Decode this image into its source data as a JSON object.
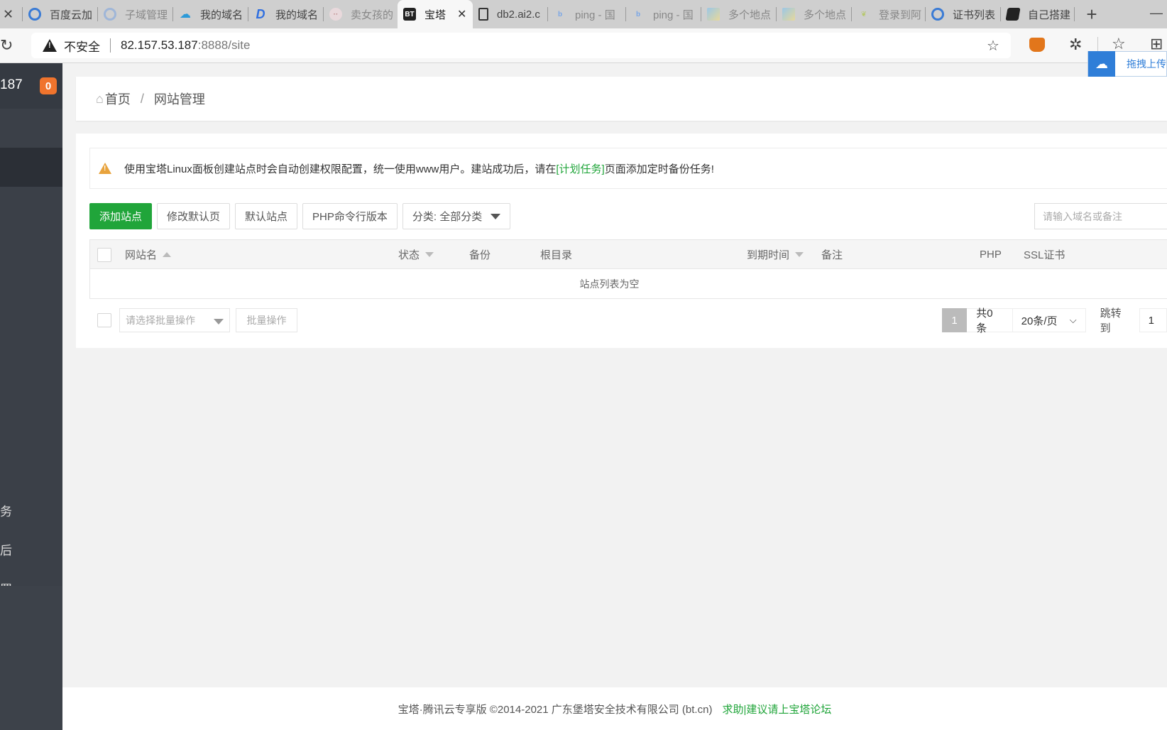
{
  "browser": {
    "tabs": [
      {
        "label": "",
        "icon": "close-icon",
        "faded": false
      },
      {
        "label": "百度云加",
        "icon": "cdn-logo-icon",
        "faded": false
      },
      {
        "label": "子域管理",
        "icon": "cdn-logo-icon",
        "faded": true
      },
      {
        "label": "我的域名",
        "icon": "cloud-logo-icon",
        "faded": false
      },
      {
        "label": "我的域名",
        "icon": "d-logo-icon",
        "faded": false
      },
      {
        "label": "卖女孩的",
        "icon": "face-icon",
        "faded": true
      },
      {
        "label": "宝塔",
        "icon": "bt-logo-icon",
        "faded": false,
        "active": true
      },
      {
        "label": "db2.ai2.c",
        "icon": "page-icon",
        "faded": false
      },
      {
        "label": "ping - 国",
        "icon": "bing-icon",
        "faded": true
      },
      {
        "label": "ping - 国",
        "icon": "bing-icon",
        "faded": true
      },
      {
        "label": "多个地点",
        "icon": "map-icon",
        "faded": true
      },
      {
        "label": "多个地点",
        "icon": "map-icon",
        "faded": true
      },
      {
        "label": "登录到阿",
        "icon": "leaf-icon",
        "faded": true
      },
      {
        "label": "证书列表",
        "icon": "cdn-logo-icon",
        "faded": false
      },
      {
        "label": "自己搭建",
        "icon": "md-logo-icon",
        "faded": false
      }
    ],
    "new_tab": "+",
    "minimize": "—",
    "address": {
      "security_label": "不安全",
      "host": "82.157.53.187",
      "path": ":8888/site"
    },
    "upload_popup": "拖拽上传"
  },
  "sidebar": {
    "server_ip_fragment": "187",
    "badge_count": "0",
    "items": [
      {
        "label": "",
        "active": false
      },
      {
        "label": "",
        "active": true
      },
      {
        "label": "务",
        "active": false
      },
      {
        "label": "后",
        "active": false
      },
      {
        "label": "置",
        "active": false
      }
    ]
  },
  "breadcrumb": {
    "home": "首页",
    "separator": "/",
    "current": "网站管理"
  },
  "alert": {
    "text_before": "使用宝塔Linux面板创建站点时会自动创建权限配置，统一使用www用户。建站成功后，请在",
    "link": "[计划任务]",
    "text_after": "页面添加定时备份任务!"
  },
  "toolbar": {
    "add_site": "添加站点",
    "edit_default_page": "修改默认页",
    "default_site": "默认站点",
    "php_cli_version": "PHP命令行版本",
    "category_filter": "分类: 全部分类",
    "search_placeholder": "请输入域名或备注"
  },
  "table": {
    "columns": [
      "网站名",
      "状态",
      "备份",
      "根目录",
      "到期时间",
      "备注",
      "PHP",
      "SSL证书"
    ],
    "empty_message": "站点列表为空",
    "rows": []
  },
  "batch": {
    "select_placeholder": "请选择批量操作",
    "button": "批量操作"
  },
  "pagination": {
    "current_page": "1",
    "total": "共0条",
    "page_size": "20条/页",
    "jump_label": "跳转到",
    "jump_value": "1"
  },
  "footer": {
    "copyright": "宝塔·腾讯云专享版 ©2014-2021 广东堡塔安全技术有限公司 (bt.cn)",
    "link": "求助|建议请上宝塔论坛"
  },
  "colors": {
    "accent_green": "#20a53a",
    "sidebar_bg": "#3b4048",
    "badge_orange": "#f0742d",
    "alert_warning": "#e8a33d"
  }
}
